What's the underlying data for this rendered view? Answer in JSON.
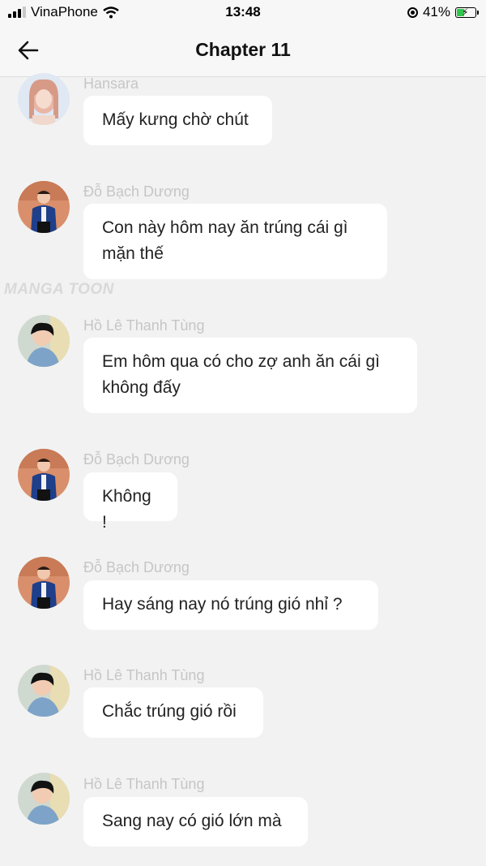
{
  "status_bar": {
    "carrier": "VinaPhone",
    "time": "13:48",
    "battery_percent": "41%",
    "battery_level": 0.41,
    "signal_bars": 3,
    "icons": [
      "signal-icon",
      "wifi-icon",
      "orientation-lock-icon",
      "battery-charging-icon"
    ]
  },
  "nav": {
    "title": "Chapter 11",
    "back_icon": "arrow-left-icon"
  },
  "watermark": "MANGA TOON",
  "colors": {
    "background": "#f2f2f2",
    "bubble": "#ffffff",
    "name": "#c6c6c6",
    "battery": "#2fc84a"
  },
  "messages": [
    {
      "sender": "Hansara",
      "text": "Mấy kưng chờ chút"
    },
    {
      "sender": "Đỗ Bạch Dương",
      "text": "Con này hôm nay ăn trúng cái gì\nmặn thế"
    },
    {
      "sender": "Hồ Lê Thanh Tùng",
      "text": "Em hôm qua có cho zợ anh ăn cái gì\nkhông đấy"
    },
    {
      "sender": "Đỗ Bạch Dương",
      "text": "Không !"
    },
    {
      "sender": "Đỗ Bạch Dương",
      "text": "Hay sáng nay nó trúng gió nhỉ ?"
    },
    {
      "sender": "Hồ Lê Thanh Tùng",
      "text": "Chắc trúng gió rồi"
    },
    {
      "sender": "Hồ Lê Thanh Tùng",
      "text": "Sang nay có gió lớn mà"
    }
  ]
}
